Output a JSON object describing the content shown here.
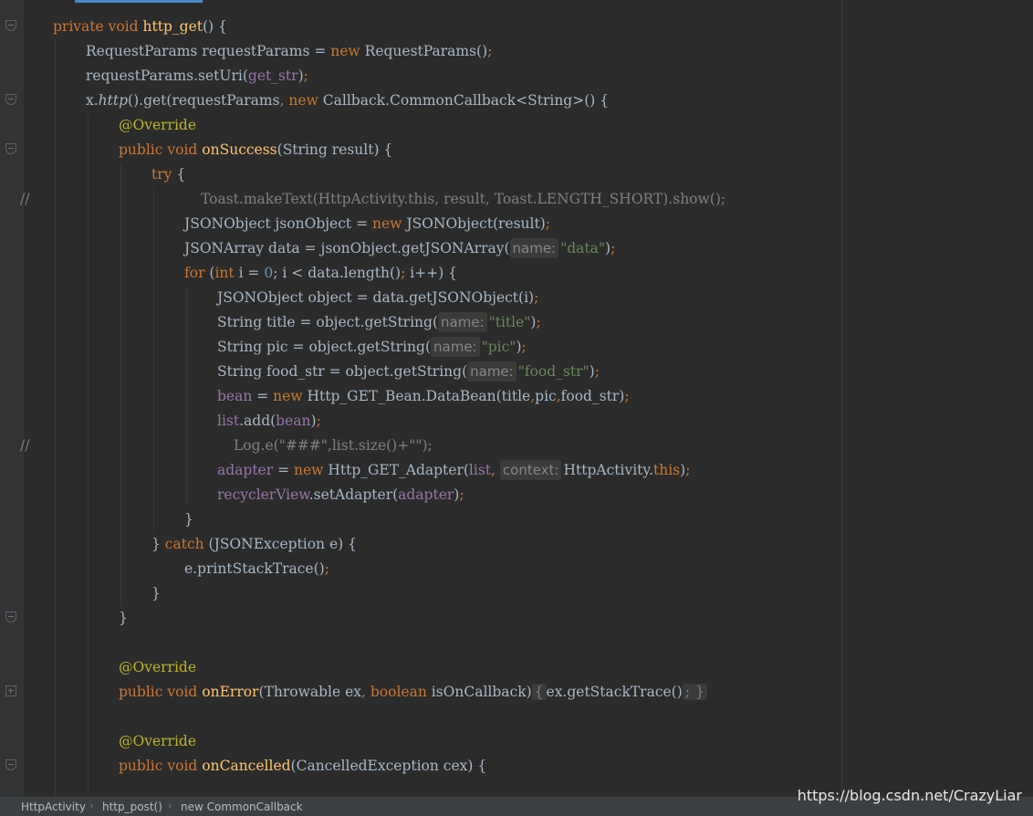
{
  "code": {
    "l1": [
      "private",
      " ",
      "void",
      " ",
      "http_get",
      "() {"
    ],
    "l2": [
      "RequestParams requestParams = ",
      "new",
      " RequestParams()",
      ";"
    ],
    "l3": [
      "requestParams.setUri(",
      "get_str",
      ")",
      ";"
    ],
    "l4": [
      "x.",
      "http",
      "().get(requestParams",
      ", ",
      "new",
      " Callback.CommonCallback<String>() {"
    ],
    "l5": [
      "@Override"
    ],
    "l6": [
      "public",
      " ",
      "void",
      " ",
      "onSuccess",
      "(String result) {"
    ],
    "l7": [
      "try",
      " {"
    ],
    "l8": [
      "//",
      "Toast.makeText(HttpActivity.this, result, Toast.LENGTH_SHORT).show();"
    ],
    "l9": [
      "JSONObject jsonObject = ",
      "new",
      " JSONObject(result)",
      ";"
    ],
    "l10": [
      "JSONArray data = jsonObject.getJSONArray(",
      "name:",
      "\"data\"",
      ")",
      ";"
    ],
    "l11": [
      "for",
      " (",
      "int",
      " i = ",
      "0",
      "; i < data.length()",
      "; ",
      "i++) {"
    ],
    "l12": [
      "JSONObject object = data.getJSONObject(i)",
      ";"
    ],
    "l13": [
      "String title = object.getString(",
      "name:",
      "\"title\"",
      ")",
      ";"
    ],
    "l14": [
      "String pic = object.getString(",
      "name:",
      "\"pic\"",
      ")",
      ";"
    ],
    "l15": [
      "String food_str = object.getString(",
      "name:",
      "\"food_str\"",
      ")",
      ";"
    ],
    "l16": [
      "bean",
      " = ",
      "new",
      " Http_GET_Bean.DataBean(title",
      ",",
      "pic",
      ",",
      "food_str)",
      ";"
    ],
    "l17": [
      "list",
      ".add(",
      "bean",
      ")",
      ";"
    ],
    "l18": [
      "//",
      "Log.e(\"###\",list.size()+\"\");"
    ],
    "l19": [
      "adapter",
      " = ",
      "new",
      " Http_GET_Adapter(",
      "list",
      ", ",
      "context:",
      "HttpActivity.",
      "this",
      ")",
      ";"
    ],
    "l20": [
      "recyclerView",
      ".setAdapter(",
      "adapter",
      ")",
      ";"
    ],
    "l21": [
      "}"
    ],
    "l22": [
      "} ",
      "catch",
      " (JSONException e) {"
    ],
    "l23": [
      "e.printStackTrace()",
      ";"
    ],
    "l24": [
      "}"
    ],
    "l25": [
      "}"
    ],
    "l27": [
      "@Override"
    ],
    "l28": [
      "public",
      " ",
      "void",
      " ",
      "onError",
      "(Throwable ex",
      ", ",
      "boolean",
      " isOnCallback)",
      "{",
      "ex.getStackTrace()",
      ";",
      "}"
    ],
    "l30": [
      "@Override"
    ],
    "l31": [
      "public",
      " ",
      "void",
      " ",
      "onCancelled",
      "(CancelledException cex) {"
    ]
  },
  "breadcrumb": [
    "HttpActivity",
    "http_post()",
    "new CommonCallback"
  ],
  "watermark": "https://blog.csdn.net/CrazyLiar",
  "colors": {
    "background": "#2b2b2b",
    "keyword": "#cc7832",
    "method": "#ffc66d",
    "string": "#6a8759",
    "field": "#9876aa",
    "annotation": "#bbb529",
    "number": "#6897bb",
    "comment": "#808080",
    "text": "#a9b7c6"
  },
  "icons": [
    "fold-collapse-icon",
    "fold-expand-icon",
    "breadcrumb-chevron-icon"
  ]
}
